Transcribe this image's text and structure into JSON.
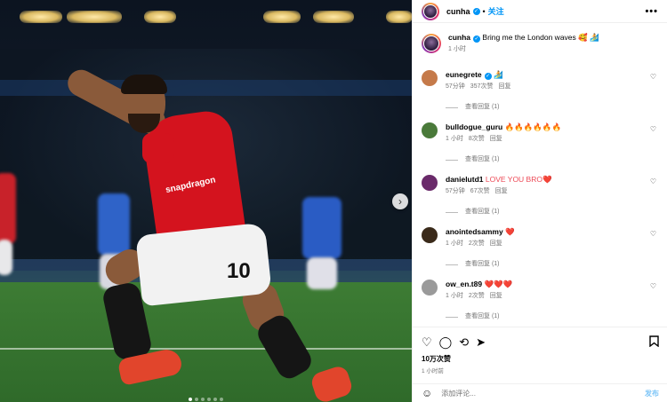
{
  "post": {
    "username": "cunha",
    "follow_label": "关注",
    "more_label": "•••",
    "caption_text": "Bring me the London waves 🥰 🏄",
    "caption_time": "1 小时",
    "image": {
      "jersey_number": "10",
      "sponsor": "snapdragon",
      "carousel_count": 6,
      "carousel_active": 0
    }
  },
  "comments": [
    {
      "user": "eunegrete",
      "verified": true,
      "text": "🏄",
      "time": "57分钟",
      "likes": "357次赞",
      "reply": "回复",
      "view_replies": "查看回复 (1)",
      "avatar_color": "#c57a4a"
    },
    {
      "user": "bulldogue_guru",
      "verified": false,
      "text": "🔥🔥🔥🔥🔥🔥",
      "time": "1 小时",
      "likes": "8次赞",
      "reply": "回复",
      "view_replies": "查看回复 (1)",
      "avatar_color": "#4a7a3a"
    },
    {
      "user": "danielutd1",
      "verified": false,
      "text": "LOVE YOU BRO❤️",
      "time": "57分钟",
      "likes": "67次赞",
      "reply": "回复",
      "view_replies": "查看回复 (1)",
      "avatar_color": "#6a2a6a"
    },
    {
      "user": "anointedsammy",
      "verified": false,
      "text": "❤️",
      "time": "1 小时",
      "likes": "2次赞",
      "reply": "回复",
      "view_replies": "查看回复 (1)",
      "avatar_color": "#3a2a1a"
    },
    {
      "user": "ow_en.t89",
      "verified": false,
      "text": "❤️❤️❤️",
      "time": "1 小时",
      "likes": "2次赞",
      "reply": "回复",
      "view_replies": "查看回复 (1)",
      "avatar_color": "#9a9a9a"
    }
  ],
  "footer": {
    "likes": "10万次赞",
    "time": "1 小时前",
    "comment_placeholder": "添加评论...",
    "post_label": "发布"
  },
  "icons": {
    "heart": "♡",
    "comment": "◯",
    "share": "⟲",
    "send": "➤",
    "bookmark": "🔖",
    "smile": "☺",
    "next": "›"
  },
  "colors": {
    "accent": "#0095f6",
    "heart": "#ed4956",
    "muted": "#737373"
  }
}
